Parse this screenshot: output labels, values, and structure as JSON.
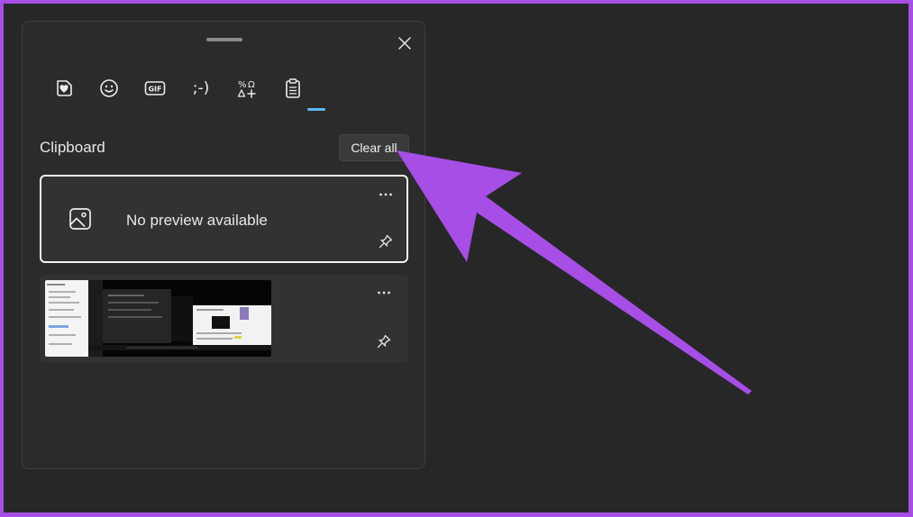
{
  "panel": {
    "tabs": [
      {
        "name": "recently-used",
        "icon": "heart-sticker-icon"
      },
      {
        "name": "emoji",
        "icon": "smiley-icon"
      },
      {
        "name": "gif",
        "icon": "gif-icon",
        "label": "GIF"
      },
      {
        "name": "kaomoji",
        "icon": "kaomoji-icon",
        "label": ";-)"
      },
      {
        "name": "symbols",
        "icon": "symbols-icon"
      },
      {
        "name": "clipboard",
        "icon": "clipboard-icon",
        "selected": true
      }
    ],
    "title": "Clipboard",
    "clear_all_label": "Clear all",
    "items": [
      {
        "type": "text",
        "preview": "No preview available"
      },
      {
        "type": "image"
      }
    ]
  },
  "colors": {
    "accent_indicator": "#60b8f0",
    "annotation_arrow": "#a64ee6",
    "frame": "#a64ee6"
  }
}
